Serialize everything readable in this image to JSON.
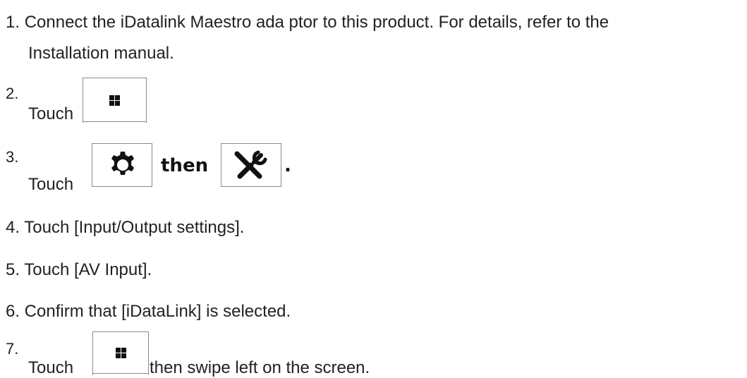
{
  "steps": {
    "s1": {
      "number": "1.",
      "line1": "Connect the iDatalink Maestro ada ptor to this product. For details, refer to the",
      "line2": "Installation manual."
    },
    "s2": {
      "number": "2.",
      "touch": "Touch",
      "icon": "home-grid-icon"
    },
    "s3": {
      "number": "3.",
      "touch": "Touch",
      "icon1": "gear-icon",
      "then": "then",
      "icon2": "tools-icon",
      "period": "."
    },
    "s4": {
      "text": "4. Touch [Input/Output settings]."
    },
    "s5": {
      "text": "5. Touch [AV Input]."
    },
    "s6": {
      "text": "6. Confirm that [iDataLink] is selected."
    },
    "s7": {
      "number": "7.",
      "touch": "Touch",
      "icon": "home-grid-icon",
      "after": "then swipe left on the screen."
    }
  },
  "colors": {
    "text": "#222222",
    "icon": "#111111",
    "box_border": "#8a8a8a"
  }
}
